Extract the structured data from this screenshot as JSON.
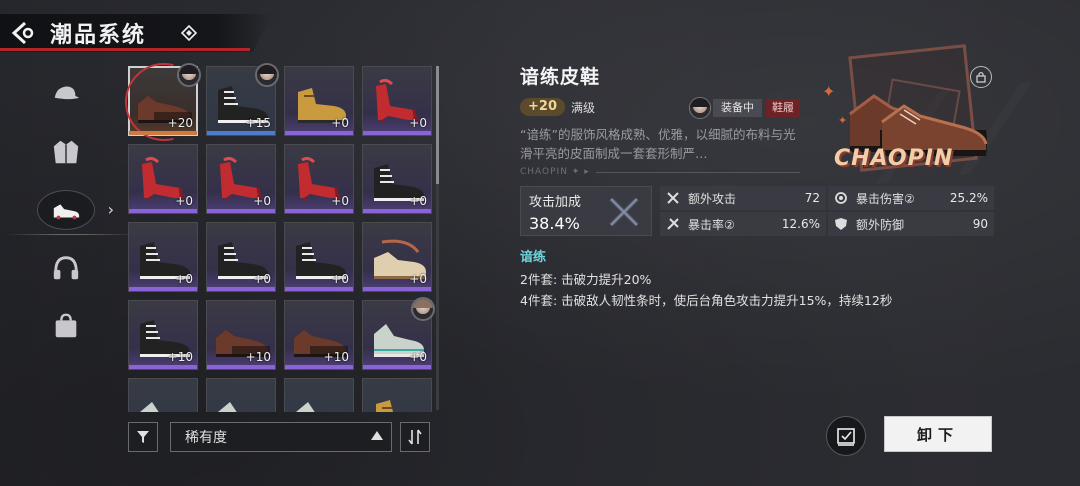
{
  "header": {
    "title": "潮品系统"
  },
  "sidebar": {
    "items": [
      {
        "icon": "cap-icon"
      },
      {
        "icon": "jacket-icon"
      },
      {
        "icon": "shoe-icon",
        "active": true
      },
      {
        "icon": "headphones-icon"
      },
      {
        "icon": "bag-icon"
      }
    ]
  },
  "inventory": {
    "items": [
      {
        "level": "+20",
        "rarity": "orange",
        "shoe": "brown",
        "avatar": "dark",
        "selected": true
      },
      {
        "level": "+15",
        "rarity": "blue",
        "shoe": "sneaker",
        "avatar": "dark"
      },
      {
        "level": "+0",
        "rarity": "purple",
        "shoe": "yellow"
      },
      {
        "level": "+0",
        "rarity": "purple",
        "shoe": "heels"
      },
      {
        "level": "+0",
        "rarity": "purple",
        "shoe": "heels"
      },
      {
        "level": "+0",
        "rarity": "purple",
        "shoe": "heels"
      },
      {
        "level": "+0",
        "rarity": "purple",
        "shoe": "heels"
      },
      {
        "level": "+0",
        "rarity": "purple",
        "shoe": "sneaker"
      },
      {
        "level": "+0",
        "rarity": "purple",
        "shoe": "sneaker"
      },
      {
        "level": "+0",
        "rarity": "purple",
        "shoe": "sneaker"
      },
      {
        "level": "+0",
        "rarity": "purple",
        "shoe": "sneaker"
      },
      {
        "level": "+0",
        "rarity": "purple",
        "shoe": "cream"
      },
      {
        "level": "+10",
        "rarity": "purple",
        "shoe": "sneaker"
      },
      {
        "level": "+10",
        "rarity": "purple",
        "shoe": "brown"
      },
      {
        "level": "+10",
        "rarity": "purple",
        "shoe": "brown"
      },
      {
        "level": "+0",
        "rarity": "purple",
        "shoe": "runner",
        "avatar": "light"
      },
      {
        "level": "",
        "rarity": "blue",
        "shoe": "runner"
      },
      {
        "level": "",
        "rarity": "blue",
        "shoe": "runner"
      },
      {
        "level": "",
        "rarity": "blue",
        "shoe": "runner"
      },
      {
        "level": "",
        "rarity": "blue",
        "shoe": "yellow"
      }
    ]
  },
  "filter": {
    "sort_label": "稀有度"
  },
  "detail": {
    "name": "谙练皮鞋",
    "plus_level": "+20",
    "max_tag": "满级",
    "equip_status": "装备中",
    "slot": "鞋履",
    "description": "“谙练”的服饰风格成熟、优雅，以细腻的布料与光滑平亮的皮面制成一套套形制严…",
    "brand_strip": "CHAOPIN ✦ ▸",
    "main_stat": {
      "label": "攻击加成",
      "value": "38.4%"
    },
    "sub_stats": [
      {
        "name": "额外攻击",
        "value": "72",
        "icon": "attack-icon"
      },
      {
        "name": "暴击伤害②",
        "value": "25.2%",
        "icon": "crit-damage-icon"
      },
      {
        "name": "暴击率②",
        "value": "12.6%",
        "icon": "crit-rate-icon"
      },
      {
        "name": "额外防御",
        "value": "90",
        "icon": "defense-icon"
      }
    ],
    "set": {
      "name": "谙练",
      "bonus2": "2件套: 击破力提升20%",
      "bonus4": "4件套: 击破敌人韧性条时，使后台角色攻击力提升15%，持续12秒"
    },
    "showcase_brand": "CHAOPIN"
  },
  "actions": {
    "unequip_label": "卸下"
  },
  "colors": {
    "accent_red": "#b5232b",
    "set_cyan": "#6fd4dd",
    "rarity_orange": "#cf7a3e",
    "rarity_purple": "#8a63d6",
    "rarity_blue": "#4d7ccf"
  }
}
